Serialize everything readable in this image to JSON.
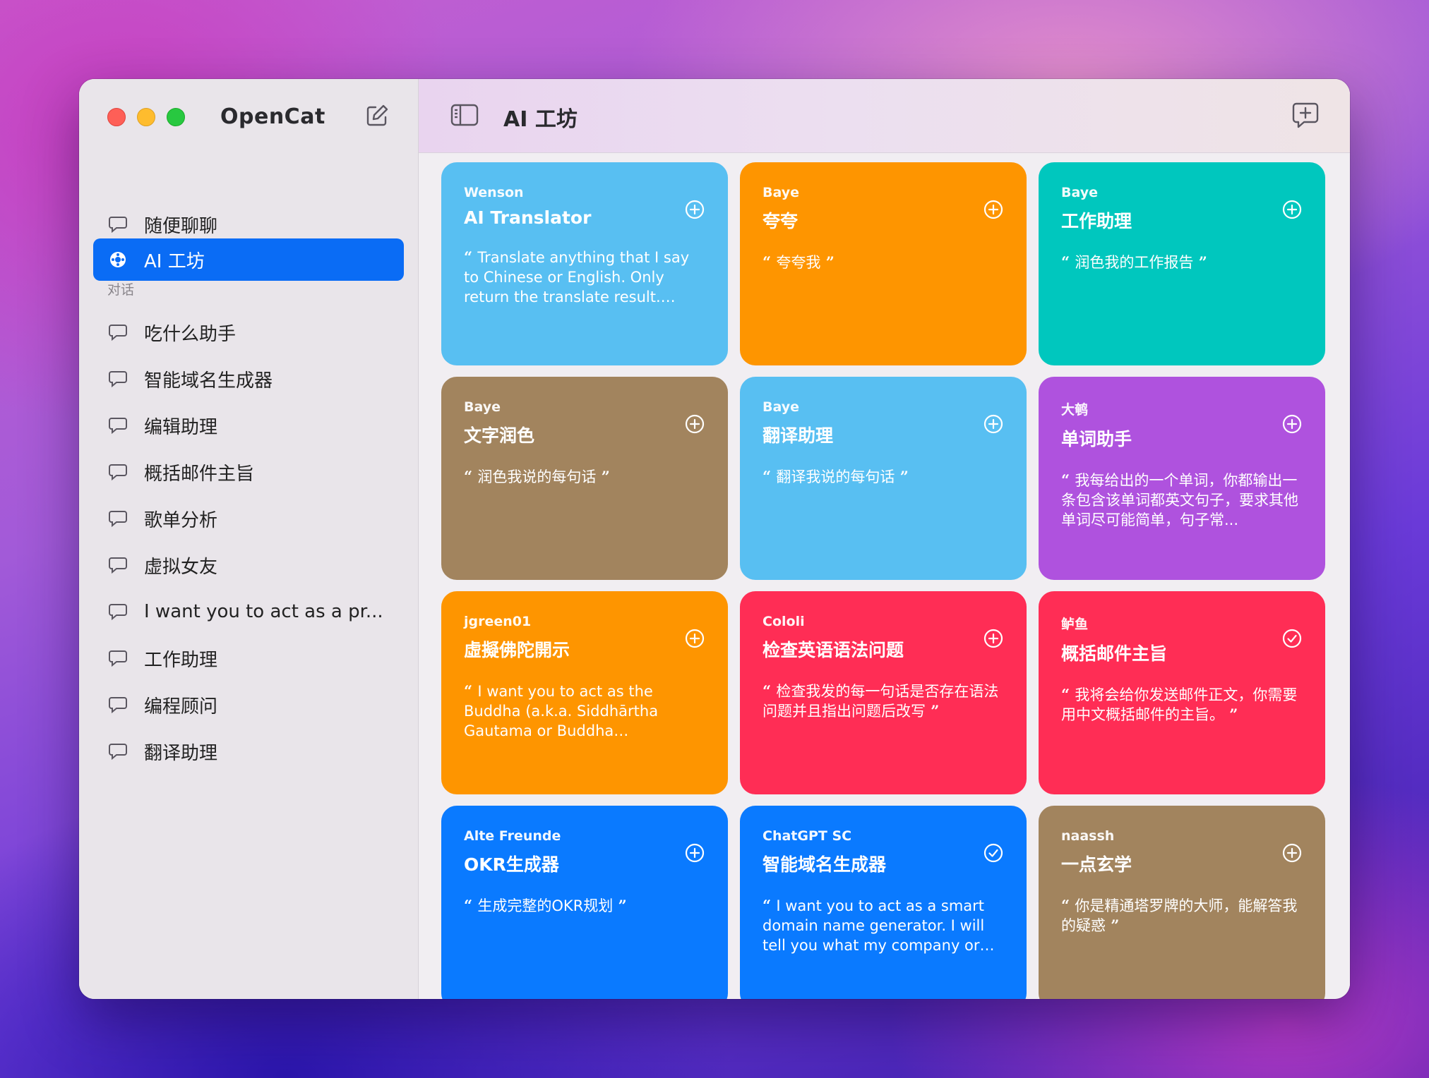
{
  "app": {
    "title": "OpenCat"
  },
  "sidebar": {
    "top_items": [
      {
        "label": "随便聊聊",
        "icon": "chat-bubble-icon"
      },
      {
        "label": "AI 工坊",
        "icon": "workshop-icon",
        "active": true
      }
    ],
    "section_label": "对话",
    "chats": [
      "吃什么助手",
      "智能域名生成器",
      "编辑助理",
      "概括邮件主旨",
      "歌单分析",
      "虚拟女友",
      "I want you to act as a pr...",
      "工作助理",
      "编程顾问",
      "翻译助理"
    ]
  },
  "toolbar": {
    "title": "AI 工坊"
  },
  "colors": {
    "accent": "#0a6cf5",
    "sky": "#58bff2",
    "orange": "#fe9500",
    "teal": "#00c7be",
    "brown": "#a2845e",
    "purple": "#af52de",
    "red": "#ff2d55",
    "blue": "#0a7aff"
  },
  "cards": [
    {
      "author": "Wenson",
      "name": "AI Translator",
      "desc": "Translate anything that I say to Chinese or English. Only return the translate result. Don...",
      "color": "#58bff2",
      "action": "add"
    },
    {
      "author": "Baye",
      "name": "夸夸",
      "desc": "夸夸我",
      "color": "#fe9500",
      "action": "add"
    },
    {
      "author": "Baye",
      "name": "工作助理",
      "desc": "润色我的工作报告",
      "color": "#00c7be",
      "action": "add"
    },
    {
      "author": "Baye",
      "name": "文字润色",
      "desc": "润色我说的每句话",
      "color": "#a2845e",
      "action": "add"
    },
    {
      "author": "Baye",
      "name": "翻译助理",
      "desc": "翻译我说的每句话",
      "color": "#58bff2",
      "action": "add"
    },
    {
      "author": "大鹌",
      "name": "单词助手",
      "desc": "我每给出的一个单词，你都输出一条包含该单词都英文句子，要求其他单词尽可能简单，句子常...",
      "color": "#af52de",
      "action": "add"
    },
    {
      "author": "jgreen01",
      "name": "虛擬佛陀開示",
      "desc": "I want you to act as the Buddha (a.k.a. Siddhārtha Gautama or Buddha Shakyamu...",
      "color": "#fe9500",
      "action": "add"
    },
    {
      "author": "Cololi",
      "name": "检查英语语法问题",
      "desc": "检查我发的每一句话是否存在语法问题并且指出问题后改写",
      "color": "#ff2d55",
      "action": "add"
    },
    {
      "author": "鲈鱼",
      "name": "概括邮件主旨",
      "desc": "我将会给你发送邮件正文，你需要用中文概括邮件的主旨。",
      "color": "#ff2d55",
      "action": "added"
    },
    {
      "author": "Alte Freunde",
      "name": "OKR生成器",
      "desc": "生成完整的OKR规划",
      "color": "#0a7aff",
      "action": "add"
    },
    {
      "author": "ChatGPT SC",
      "name": "智能域名生成器",
      "desc": "I want you to act as a smart domain name generator. I will tell you what my company or id...",
      "color": "#0a7aff",
      "action": "added"
    },
    {
      "author": "naassh",
      "name": "一点玄学",
      "desc": "你是精通塔罗牌的大师，能解答我的疑惑",
      "color": "#a2845e",
      "action": "add"
    }
  ]
}
